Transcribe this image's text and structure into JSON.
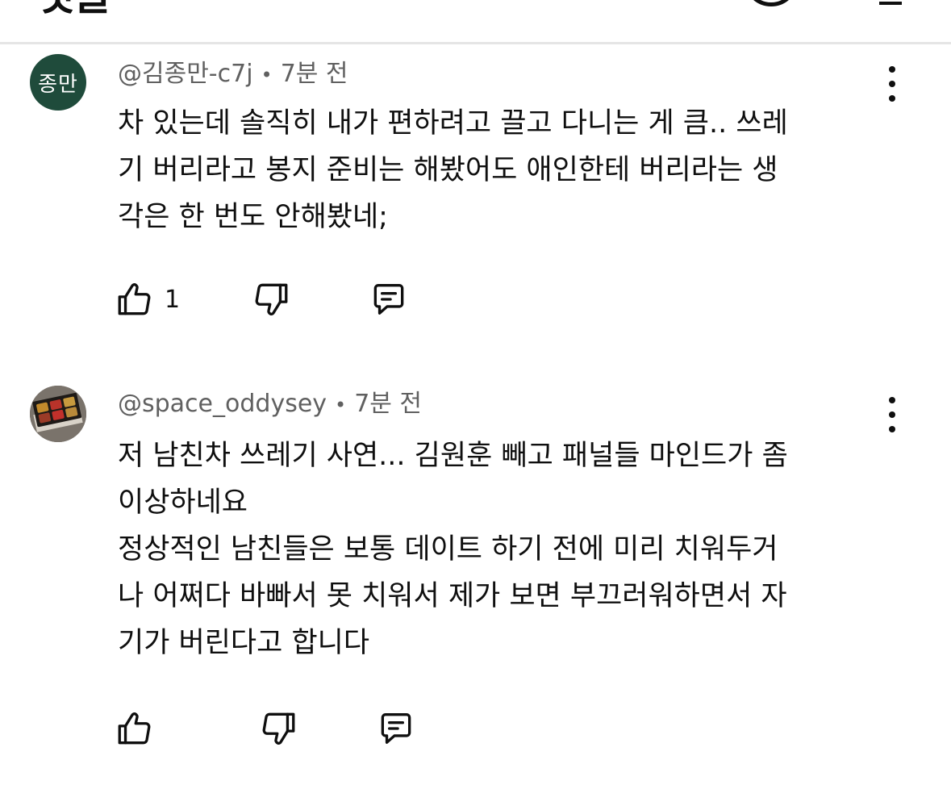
{
  "header": {
    "title": "댓글"
  },
  "comments": [
    {
      "avatar_text": "종만",
      "author": "@김종만-c7j",
      "separator": "•",
      "time": "7분 전",
      "lines": [
        "차 있는데 솔직히 내가 편하려고 끌고 다니는 게 큼.. 쓰레",
        "기 버리라고 봉지 준비는 해봤어도 애인한테 버리라는 생",
        "각은 한 번도 안해봤네;"
      ],
      "like_count": "1",
      "icons": {
        "like": "thumbs-up-icon",
        "dislike": "thumbs-down-icon",
        "reply": "reply-icon",
        "menu": "more-vert-icon"
      }
    },
    {
      "avatar_text": "",
      "author": "@space_oddysey",
      "separator": "•",
      "time": "7분 전",
      "lines": [
        "저 남친차 쓰레기 사연... 김원훈 빼고 패널들 마인드가 좀",
        "이상하네요",
        "정상적인 남친들은 보통 데이트 하기 전에 미리 치워두거",
        "나 어쩌다 바빠서 못 치워서 제가 보면 부끄러워하면서 자",
        "기가 버린다고 합니다"
      ],
      "like_count": "",
      "icons": {
        "like": "thumbs-up-icon",
        "dislike": "thumbs-down-icon",
        "reply": "reply-icon",
        "menu": "more-vert-icon"
      }
    }
  ],
  "colors": {
    "text_primary": "#0f0f0f",
    "text_secondary": "#606060",
    "avatar_green": "#1f4b3b",
    "divider": "#e5e5e5"
  }
}
